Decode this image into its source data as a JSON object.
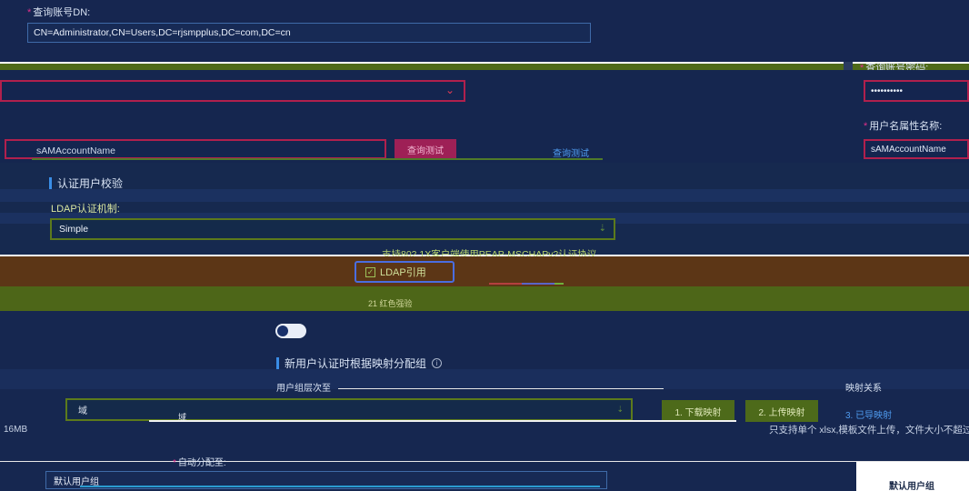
{
  "query_dn": {
    "label": "查询账号DN:",
    "value": "CN=Administrator,CN=Users,DC=rjsmpplus,DC=com,DC=cn"
  },
  "query_password": {
    "label": "查询账号密码:",
    "value": "••••••••••"
  },
  "username_attr": {
    "label": "用户名属性名称:",
    "value": "sAMAccountName"
  },
  "left_attr_value": "sAMAccountName",
  "query_button_label": "查询测试",
  "auth_check": {
    "title": "认证用户校验",
    "mechanism_label": "LDAP认证机制:",
    "mechanism_value": "Simple",
    "protocol_hint": "支持802.1X客户端使用PEAP-MSCHAPv2认证协议"
  },
  "ldap_ref": {
    "label": "LDAP引用",
    "checked": true
  },
  "toggle_hint": "21 红色强验",
  "group_mapping": {
    "title": "新用户认证时根据映射分配组",
    "group_hint_label": "用户组层次至",
    "map_label": "映射关系",
    "attr_value": "域",
    "attr_value2": "域",
    "download_button": "1. 下载映射",
    "upload_button": "2. 上传映射",
    "export_link": "3. 已导映射",
    "size_left": "16MB",
    "upload_hint": "只支持单个 xlsx,模板文件上传，文件大小不超过"
  },
  "auto_assign": {
    "label": "自动分配至:",
    "value": "默认用户组"
  },
  "default_group": "默认用户组"
}
